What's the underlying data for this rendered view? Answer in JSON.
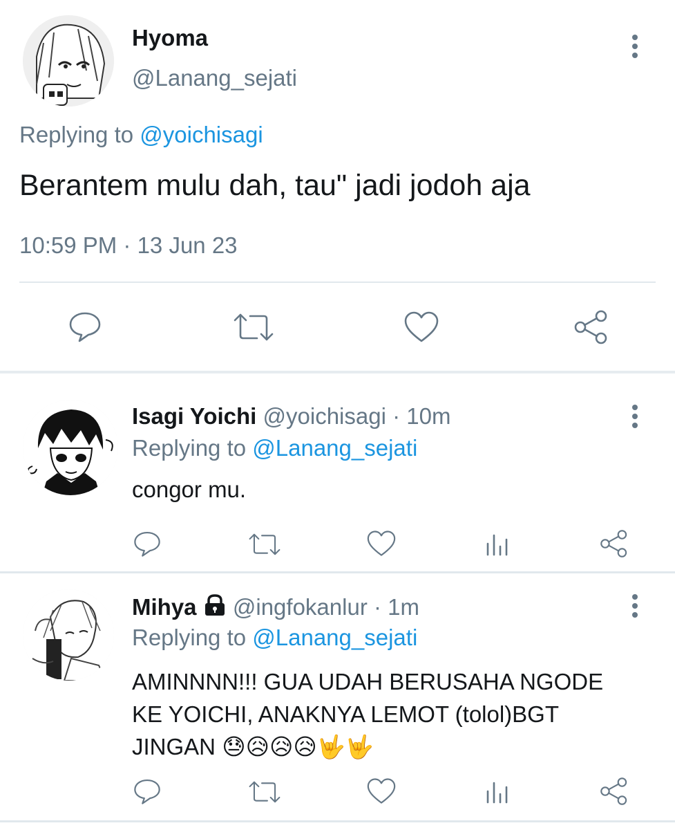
{
  "main_tweet": {
    "display_name": "Hyoma",
    "handle": "@Lanang_sejati",
    "replying_prefix": "Replying to ",
    "replying_to": "@yoichisagi",
    "text": "Berantem mulu dah, tau\" jadi jodoh aja",
    "time": "10:59 PM",
    "separator": " · ",
    "date": "13 Jun 23"
  },
  "replies": [
    {
      "display_name": "Isagi Yoichi",
      "handle": "@yoichisagi",
      "separator": " · ",
      "time": "10m",
      "replying_prefix": "Replying to ",
      "replying_to": "@Lanang_sejati",
      "text": "congor mu."
    },
    {
      "display_name": "Mihya",
      "protected_icon": "lock-icon",
      "handle": "@ingfokanlur",
      "separator": " · ",
      "time": "1m",
      "replying_prefix": "Replying to ",
      "replying_to": "@Lanang_sejati",
      "text_lines": [
        "AMINNNN!!! GUA UDAH BERUSAHA NGODE",
        "KE YOICHI, ANAKNYA LEMOT (tolol)BGT",
        "JINGAN"
      ],
      "emojis": [
        "😓",
        "😥",
        "😥",
        "😥",
        "🤟",
        "🤟"
      ]
    }
  ],
  "icons": {
    "more": "more-vertical-icon",
    "reply": "reply-icon",
    "retweet": "retweet-icon",
    "like": "like-icon",
    "analytics": "analytics-icon",
    "share": "share-icon"
  },
  "colors": {
    "link": "#1b95e0",
    "secondary_text": "#657786",
    "divider": "#e1e8ed"
  }
}
